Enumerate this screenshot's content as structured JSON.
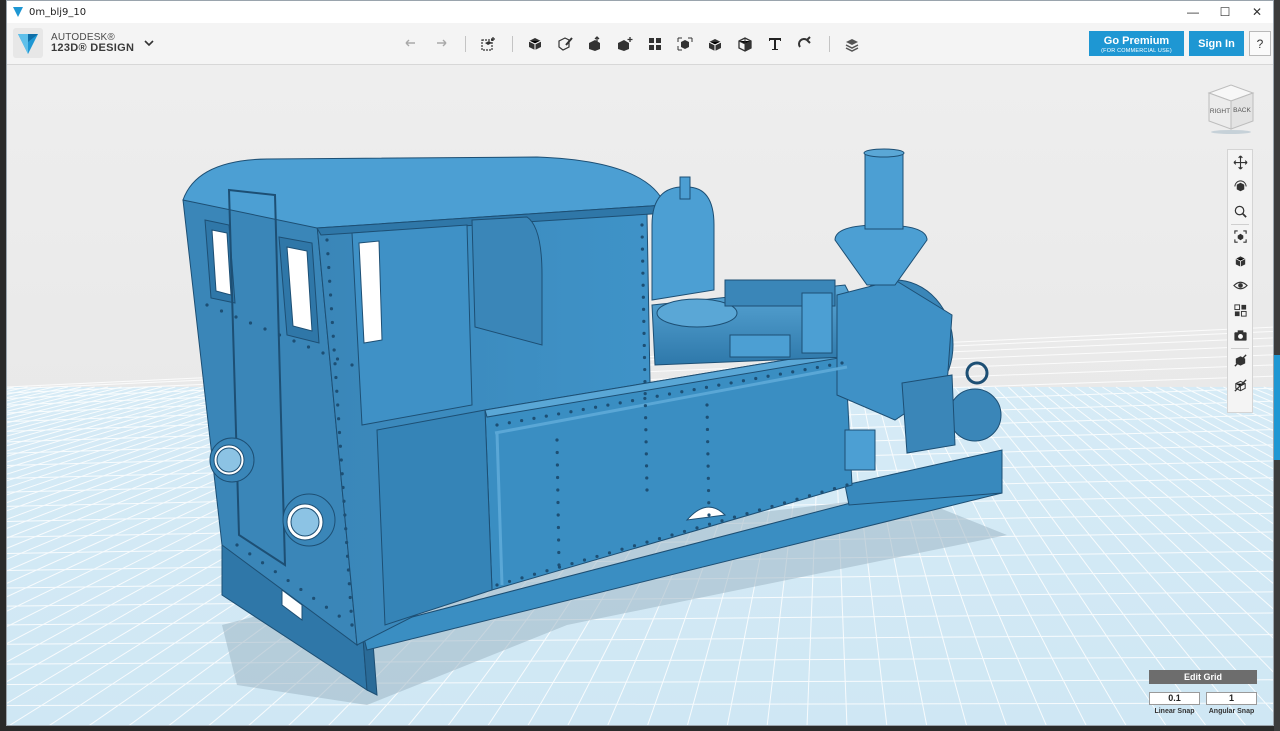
{
  "window": {
    "title": "0m_blj9_10",
    "minimize_glyph": "—",
    "maximize_glyph": "☐",
    "close_glyph": "✕"
  },
  "logo": {
    "line1": "AUTODESK®",
    "line2": "123D® DESIGN",
    "menu_icon": "chevron-down-icon"
  },
  "toolbar": {
    "tools": [
      {
        "name": "undo",
        "icon": "undo-icon"
      },
      {
        "name": "redo",
        "icon": "redo-icon"
      },
      {
        "name": "transform",
        "icon": "transform-icon"
      },
      {
        "name": "primitives",
        "icon": "box-primitive-icon"
      },
      {
        "name": "sketch",
        "icon": "sketch-icon"
      },
      {
        "name": "construct",
        "icon": "construct-icon"
      },
      {
        "name": "modify",
        "icon": "modify-icon"
      },
      {
        "name": "pattern",
        "icon": "pattern-icon"
      },
      {
        "name": "grouping",
        "icon": "grouping-icon"
      },
      {
        "name": "combine",
        "icon": "combine-icon"
      },
      {
        "name": "measure",
        "icon": "measure-icon"
      },
      {
        "name": "text",
        "icon": "text-icon",
        "glyph": "T"
      },
      {
        "name": "snap",
        "icon": "snap-magnet-icon"
      },
      {
        "name": "material",
        "icon": "material-icon"
      }
    ]
  },
  "account": {
    "premium_label": "Go Premium",
    "premium_sub": "(FOR COMMERCIAL USE)",
    "signin_label": "Sign In",
    "help_label": "?"
  },
  "viewcube": {
    "left_face": "RIGHT",
    "right_face": "BACK"
  },
  "nav_tools": [
    {
      "name": "pan",
      "icon": "pan-icon"
    },
    {
      "name": "orbit",
      "icon": "orbit-icon"
    },
    {
      "name": "zoom",
      "icon": "zoom-icon"
    },
    {
      "name": "fit",
      "icon": "fit-icon"
    },
    {
      "name": "views",
      "icon": "view-cube-icon"
    },
    {
      "name": "visibility",
      "icon": "eye-icon"
    },
    {
      "name": "material-view",
      "icon": "material-view-icon"
    },
    {
      "name": "screenshot",
      "icon": "camera-icon"
    },
    {
      "name": "wireframe",
      "icon": "solid-shaded-icon"
    },
    {
      "name": "shaded",
      "icon": "wireframe-icon"
    }
  ],
  "grid": {
    "edit_label": "Edit Grid",
    "linear_snap_value": "0.1",
    "linear_snap_label": "Linear Snap",
    "angular_snap_value": "1",
    "angular_snap_label": "Angular Snap"
  },
  "colors": {
    "model": "#3b8ec0",
    "model_dark": "#2a6f9e",
    "accent": "#1e97d3",
    "grid_bg": "#d9ecf7",
    "grid_line": "#ffffff"
  }
}
